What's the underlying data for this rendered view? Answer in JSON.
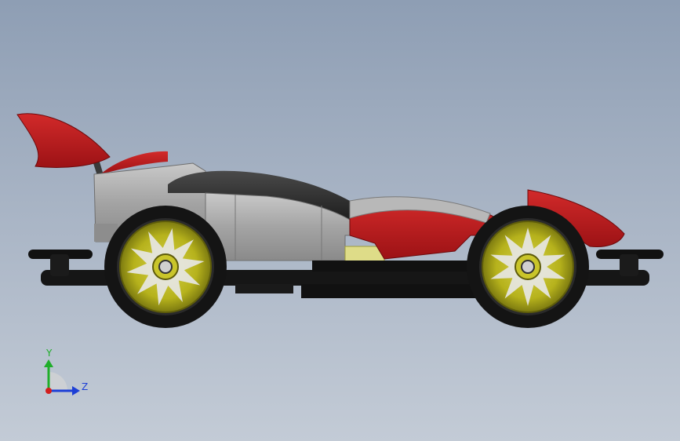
{
  "triad": {
    "y_label": "Y",
    "z_label": "Z",
    "y_color": "#1fae2a",
    "z_color": "#1d3fd6",
    "x_color": "#d21e1e"
  },
  "colors": {
    "body_red": "#b3171b",
    "body_gray": "#a2a2a2",
    "body_dark": "#2c2c2c",
    "chassis_black": "#141414",
    "wheel_rim": "#c2c024",
    "tire": "#1a1a1a"
  }
}
